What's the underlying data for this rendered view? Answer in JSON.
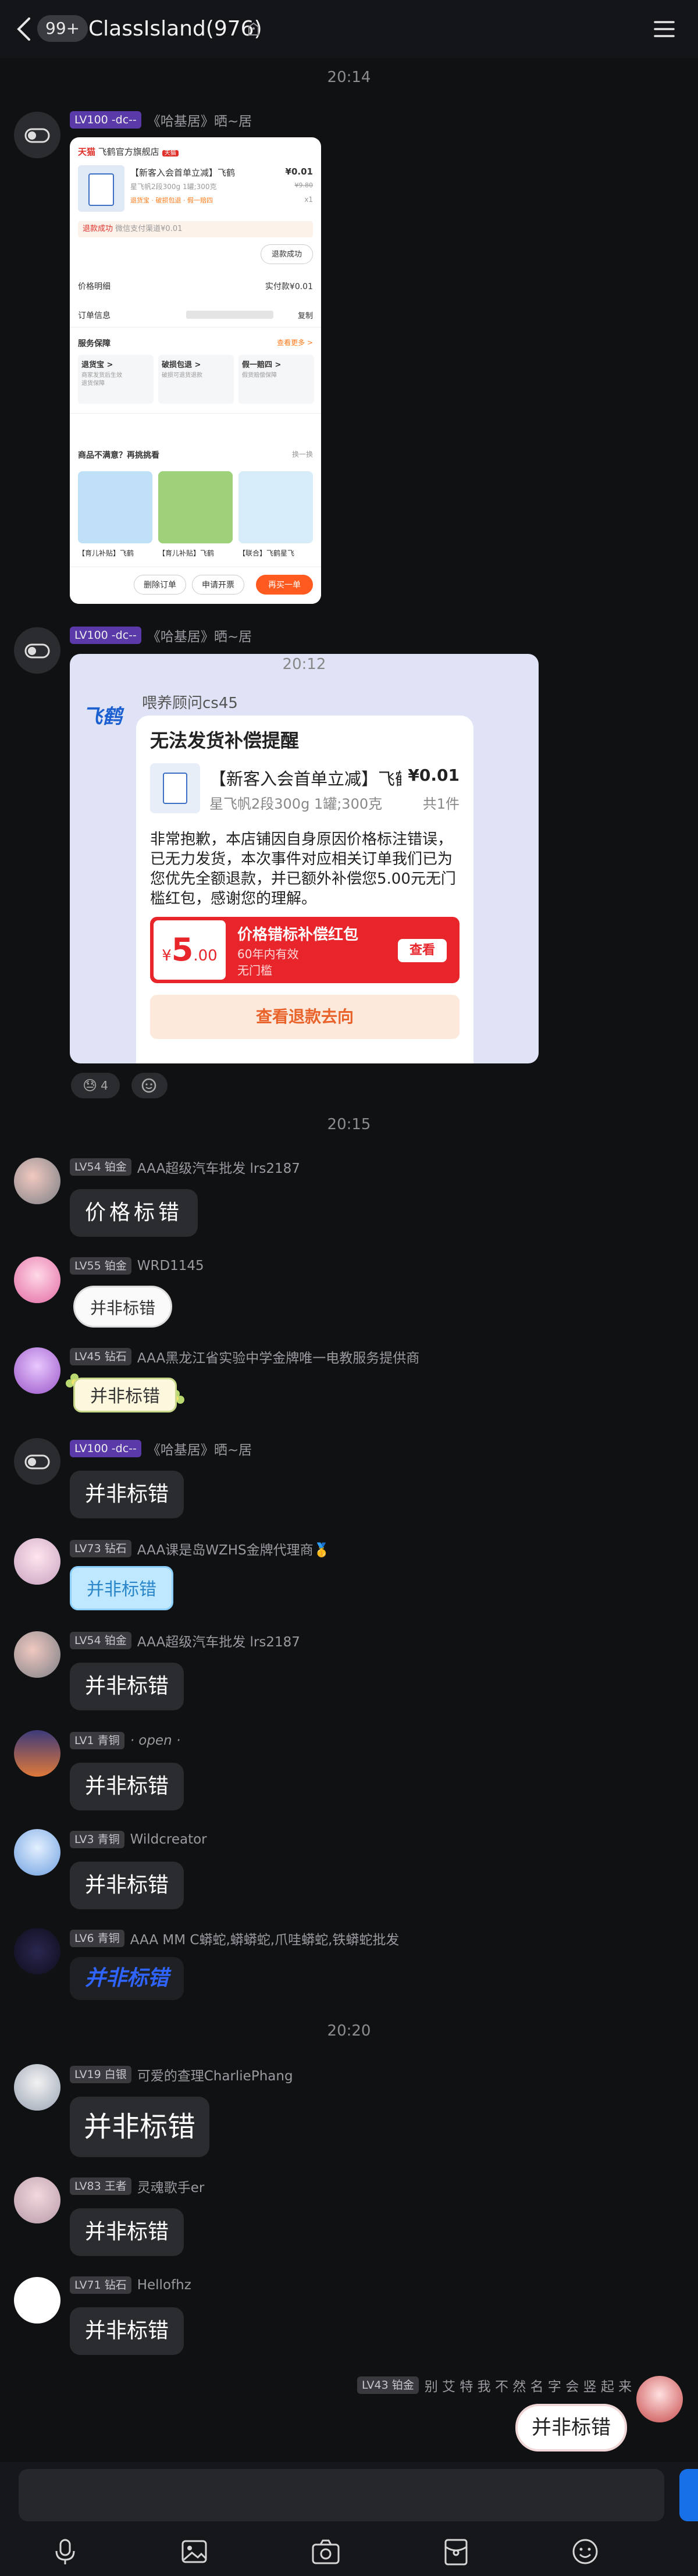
{
  "header": {
    "unread_count": "99+",
    "title": "ClassIsland(976)"
  },
  "times": {
    "t1": "20:14",
    "t2": "20:15",
    "t3": "20:20"
  },
  "messages": {
    "m1": {
      "badge": "LV100 -dc--",
      "nick": "《哈基居》晒~居"
    },
    "m2": {
      "badge": "LV100 -dc--",
      "nick": "《哈基居》晒~居"
    },
    "m3": {
      "badge": "LV54 铂金",
      "nick": "AAA超级汽车批发 lrs2187",
      "text": "价格标错"
    },
    "m4": {
      "badge": "LV55 铂金",
      "nick": "WRD1145",
      "text": "并非标错"
    },
    "m5": {
      "badge": "LV45 钻石",
      "nick": "AAA黑龙江省实验中学金牌唯一电教服务提供商",
      "text": "并非标错"
    },
    "m6": {
      "badge": "LV100 -dc--",
      "nick": "《哈基居》晒~居",
      "text": "并非标错"
    },
    "m7": {
      "badge": "LV73 钻石",
      "nick": "AAA课是岛WZHS金牌代理商🥇",
      "text": "并非标错"
    },
    "m8": {
      "badge": "LV54 铂金",
      "nick": "AAA超级汽车批发 lrs2187",
      "text": "并非标错"
    },
    "m9": {
      "badge": "LV1 青铜",
      "nick": "· open ·",
      "text": "并非标错"
    },
    "m10": {
      "badge": "LV3 青铜",
      "nick": "Wildcreator",
      "text": "并非标错"
    },
    "m11": {
      "badge": "LV6 青铜",
      "nick": "AAA MM C蟒蛇,蟒蟒蛇,爪哇蟒蛇,铁蟒蛇批发",
      "text": "并非标错"
    },
    "m12": {
      "badge": "LV19 白银",
      "nick": "可爱的查理CharliePhang",
      "text": "并非标错"
    },
    "m13": {
      "badge": "LV83 王者",
      "nick": "灵魂歌手er",
      "text": "并非标错"
    },
    "m14": {
      "badge": "LV71 钻石",
      "nick": "Hellofhz",
      "text": "并非标错"
    },
    "m15": {
      "badge": "LV43 铂金",
      "nick": "别 艾 特 我 不 然 名 字 会 竖 起 来",
      "text": "并非标错"
    }
  },
  "screenshot": {
    "shop": "飞鹤官方旗舰店",
    "tmall": "天猫",
    "product": "【新客入会首单立减】飞鹤",
    "spec": "星飞帆2段300g 1罐;300克",
    "price": "¥0.01",
    "old_price": "¥9.80",
    "qty": "x1",
    "refund_tag": "退款成功",
    "refund_note": "微信支付渠道¥0.01",
    "refund_btn": "退款成功",
    "price_detail": "价格明细",
    "paid": "实付款¥0.01",
    "order_info": "订单信息",
    "copy": "复制",
    "service": "服务保障",
    "more": "查看更多 >",
    "svc1": "退货宝 >",
    "svc2": "破损包退 >",
    "svc3": "假一赔四 >",
    "rec_title": "商品不满意？再挑挑看",
    "rec_change": "换一换",
    "p1": "【育儿补贴】飞鹤",
    "p2": "【育儿补贴】飞鹤",
    "p3": "【联合】飞鹤星飞",
    "btn_delete": "删除订单",
    "btn_invoice": "申请开票",
    "btn_buy": "再买一单"
  },
  "notice": {
    "time": "20:12",
    "brand": "飞鹤",
    "sender": "喂养顾问cs45",
    "heading": "无法发货补偿提醒",
    "product": "【新客入会首单立减】飞鹤…",
    "price": "¥0.01",
    "spec": "星飞帆2段300g 1罐;300克",
    "qty": "共1件",
    "body": "非常抱歉，本店铺因自身原因价格标注错误，已无力发货，本次事件对应相关订单我们已为您优先全额退款，并已额外补偿您5.00元无门槛红包，感谢您的理解。",
    "coupon_amount": "5",
    "coupon_decimal": ".00",
    "coupon_currency": "¥",
    "coupon_title": "价格错标补偿红包",
    "coupon_valid": "60年内有效",
    "coupon_cond": "无门槛",
    "coupon_btn": "查看",
    "refund_btn": "查看退款去向",
    "reaction_count": "4"
  },
  "colors": {
    "background": "#101113",
    "bubble": "#2b2c30",
    "tmall_red": "#e0302a",
    "coupon_red": "#e8252b",
    "send_blue": "#1770e8"
  }
}
